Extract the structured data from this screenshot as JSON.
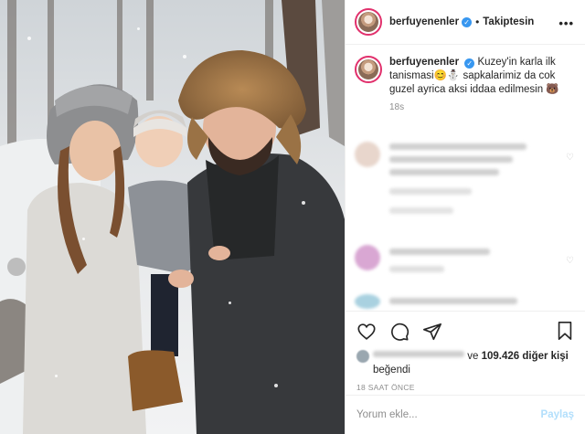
{
  "post": {
    "author": {
      "username": "berfuyenenler",
      "follow_status": "Takiptesin"
    },
    "caption": {
      "username": "berfuyenenler",
      "text": "Kuzey'in karla ilk tanismasi",
      "emoji1": "😊",
      "emoji2": "⛄",
      "text2": "sapkalarimiz da cok guzel ayrica aksi iddaa edilmesin",
      "emoji3": "🐻",
      "time": "18s"
    },
    "comments": [
      {
        "line1_width": 150,
        "line2_width": 135,
        "line3_width": 120
      },
      {
        "line1_width": 110,
        "line2_width": 60
      },
      {
        "line1_width": 140
      }
    ],
    "likes": {
      "connector": "ve",
      "count": "109.426",
      "suffix": "diğer kişi",
      "line2": "beğendi"
    },
    "post_time": "18 SAAT ÖNCE",
    "add_comment": {
      "placeholder": "Yorum ekle...",
      "post_label": "Paylaş"
    },
    "icons": [
      "heart-icon",
      "comment-icon",
      "share-icon",
      "bookmark-icon",
      "more-options-icon",
      "verified-badge-icon"
    ],
    "colors": {
      "verified": "#3897f0",
      "story_ring": "#e1306c",
      "post_button": "#b2dffc",
      "secondary_text": "#8e8e8e"
    }
  }
}
